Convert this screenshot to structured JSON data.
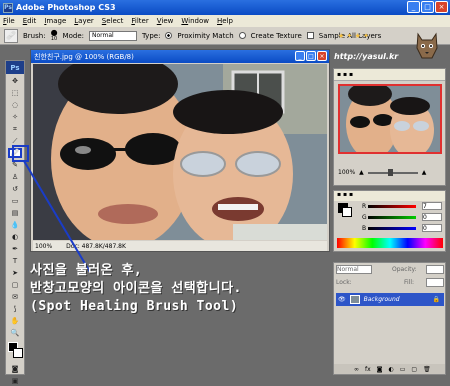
{
  "app": {
    "title": "Adobe Photoshop CS3",
    "icon": "Ps"
  },
  "window_buttons": [
    "_",
    "□",
    "×"
  ],
  "menu": [
    "File",
    "Edit",
    "Image",
    "Layer",
    "Select",
    "Filter",
    "View",
    "Window",
    "Help"
  ],
  "options": {
    "brush_label": "Brush:",
    "brush_size": "10",
    "mode_label": "Mode:",
    "mode_value": "Normal",
    "type_label": "Type:",
    "proximity_label": "Proximity Match",
    "texture_label": "Create Texture",
    "sample_label": "Sample All Layers"
  },
  "logo": {
    "url": "http://yasul.kr"
  },
  "document": {
    "title": "친한친구.jpg @ 100% (RGB/8)",
    "zoom": "100%",
    "doc_size": "Doc: 487.8K/487.8K"
  },
  "navigator": {
    "zoom": "100%"
  },
  "color_panel": {
    "r_value": "7",
    "g_value": "0",
    "b_value": "0",
    "r_label": "R",
    "g_label": "G",
    "b_label": "B"
  },
  "layers_panel": {
    "blend_mode": "Normal",
    "opacity_label": "Opacity:",
    "fill_label": "Fill:",
    "lock_label": "Lock:",
    "layer_name": "Background"
  },
  "caption": {
    "line1": "사진을 불러온 후,",
    "line2": "반창고모양의 아이콘을 선택합니다.",
    "line3": "(Spot Healing Brush Tool)"
  },
  "colors": {
    "accent_blue": "#1a3cc8",
    "titlebar": "#0a4bc4"
  }
}
